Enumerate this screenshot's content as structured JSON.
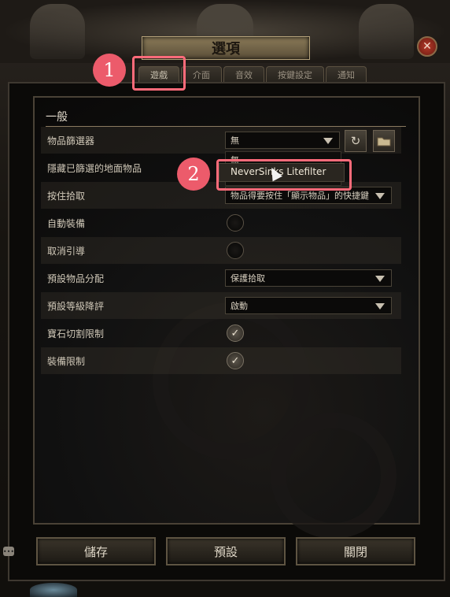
{
  "window": {
    "title": "選項",
    "close_symbol": "✕"
  },
  "tabs": [
    {
      "label": "遊戲",
      "active": true
    },
    {
      "label": "介面",
      "active": false
    },
    {
      "label": "音效",
      "active": false
    },
    {
      "label": "按鍵設定",
      "active": false
    },
    {
      "label": "通知",
      "active": false
    }
  ],
  "section": {
    "title": "一般"
  },
  "settings": {
    "item_filter": {
      "label": "物品篩選器",
      "value": "無"
    },
    "hide_filtered": {
      "label": "隱藏已篩選的地面物品"
    },
    "hold_pickup": {
      "label": "按住拾取",
      "value": "物品得要按住「顯示物品」的快捷鍵"
    },
    "auto_equip": {
      "label": "自動裝備",
      "checked": false
    },
    "cancel_guide": {
      "label": "取消引導",
      "checked": false
    },
    "default_alloc": {
      "label": "預設物品分配",
      "value": "保護拾取"
    },
    "default_level": {
      "label": "預設等級降評",
      "value": "啟動"
    },
    "gem_cut": {
      "label": "寶石切割限制",
      "checked": true
    },
    "equip_limit": {
      "label": "裝備限制",
      "checked": true
    }
  },
  "dropdown_open": {
    "items": [
      "無",
      "NeverSinks Litefilter"
    ]
  },
  "icons": {
    "refresh": "↻",
    "folder": "▬",
    "check": "✓"
  },
  "annotations": {
    "badge1": "1",
    "badge2": "2",
    "color": "#ec5b6b"
  },
  "footer": {
    "save": "儲存",
    "default": "預設",
    "close": "關閉"
  }
}
